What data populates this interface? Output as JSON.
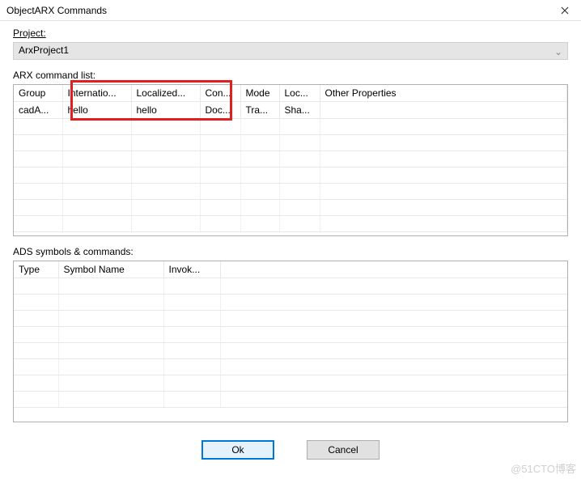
{
  "window": {
    "title": "ObjectARX Commands"
  },
  "project": {
    "label": "Project:",
    "value": "ArxProject1"
  },
  "arx": {
    "label": "ARX command list:",
    "headers": [
      "Group",
      "Internatio...",
      "Localized...",
      "Con...",
      "Mode",
      "Loc...",
      "Other Properties"
    ],
    "row": [
      "cadA...",
      "hello",
      "hello",
      "Doc...",
      "Tra...",
      "Sha...",
      ""
    ]
  },
  "ads": {
    "label": "ADS symbols & commands:",
    "headers": [
      "Type",
      "Symbol Name",
      "Invok..."
    ]
  },
  "buttons": {
    "ok": "Ok",
    "cancel": "Cancel"
  },
  "watermark": "@51CTO博客"
}
